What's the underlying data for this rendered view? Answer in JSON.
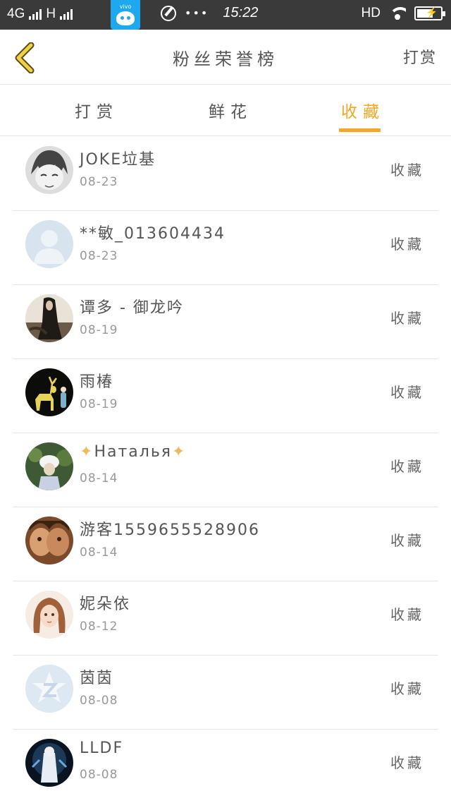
{
  "status_bar": {
    "network_left": "4G",
    "network_right": "H",
    "vivo_label": "vivo",
    "dots": "•••",
    "time": "15:22",
    "hd": "HD"
  },
  "header": {
    "title": "粉丝荣誉榜",
    "right_action": "打赏"
  },
  "tabs": [
    {
      "label": "打赏",
      "active": false
    },
    {
      "label": "鲜花",
      "active": false
    },
    {
      "label": "收藏",
      "active": true
    }
  ],
  "accent_color": "#f5a623",
  "list": [
    {
      "name": "JOKE垃基",
      "date": "08-23",
      "action": "收藏"
    },
    {
      "name": "**敏_013604434",
      "date": "08-23",
      "action": "收藏"
    },
    {
      "name": "谭多 - 御龙吟",
      "date": "08-19",
      "action": "收藏"
    },
    {
      "name": "雨椿",
      "date": "08-19",
      "action": "收藏"
    },
    {
      "name": "Наталья",
      "name_prefix": "✦",
      "name_suffix": "✦",
      "date": "08-14",
      "action": "收藏"
    },
    {
      "name": "游客1559655528906",
      "date": "08-14",
      "action": "收藏"
    },
    {
      "name": "妮朵依",
      "date": "08-12",
      "action": "收藏"
    },
    {
      "name": "茵茵",
      "date": "08-08",
      "action": "收藏"
    },
    {
      "name": "LLDF",
      "date": "08-08",
      "action": "收藏"
    }
  ]
}
